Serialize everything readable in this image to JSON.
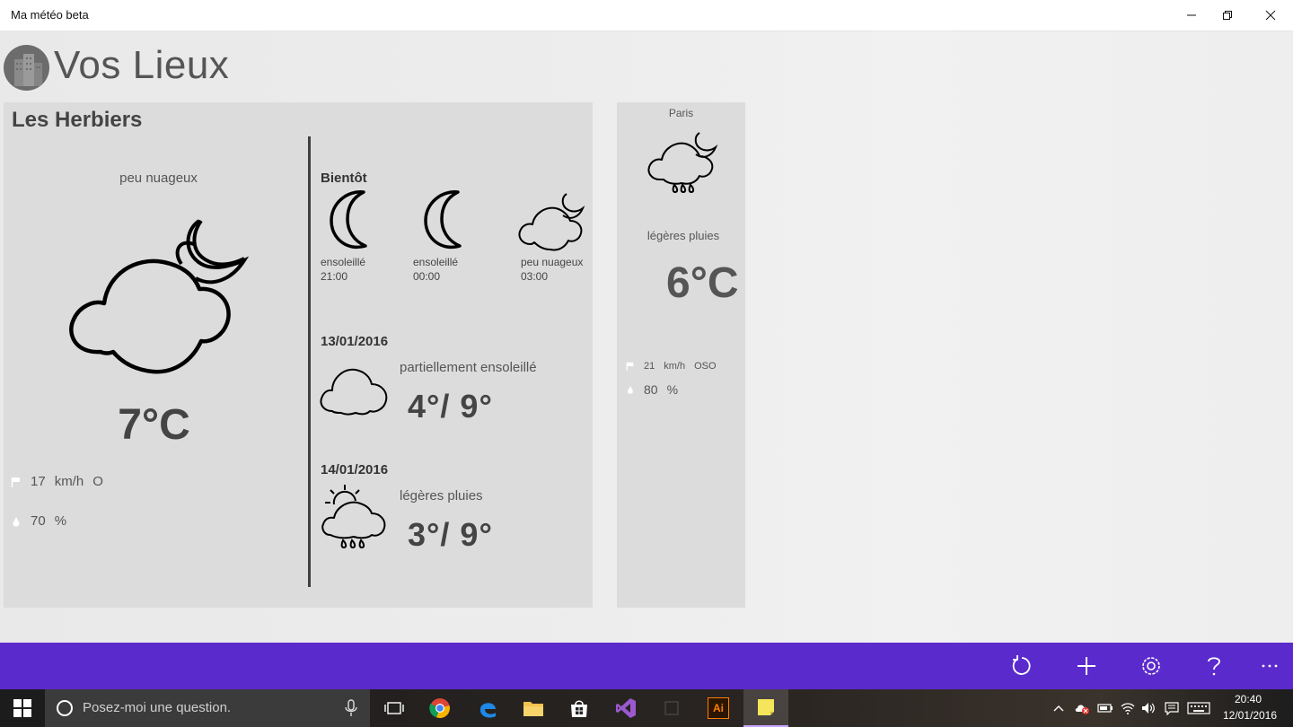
{
  "window": {
    "title": "Ma météo beta"
  },
  "header": {
    "title": "Vos Lieux"
  },
  "main_card": {
    "city": "Les Herbiers",
    "current": {
      "description": "peu nuageux",
      "temperature": "7°C",
      "wind_speed": "17",
      "wind_unit": "km/h",
      "wind_dir": "O",
      "humidity": "70",
      "humidity_unit": "%"
    },
    "soon": {
      "label": "Bientôt",
      "items": [
        {
          "description": "ensoleillé",
          "time": "21:00",
          "icon": "moon-icon"
        },
        {
          "description": "ensoleillé",
          "time": "00:00",
          "icon": "moon-icon"
        },
        {
          "description": "peu nuageux",
          "time": "03:00",
          "icon": "cloud-moon-icon"
        }
      ]
    },
    "days": [
      {
        "date": "13/01/2016",
        "description": "partiellement ensoleillé",
        "temps": "4°/ 9°",
        "icon": "cloud-icon"
      },
      {
        "date": "14/01/2016",
        "description": "légères pluies",
        "temps": "3°/ 9°",
        "icon": "sun-cloud-rain-icon"
      }
    ]
  },
  "paris_card": {
    "city": "Paris",
    "description": "légères pluies",
    "temperature": "6°C",
    "wind_speed": "21",
    "wind_unit": "km/h",
    "wind_dir": "OSO",
    "humidity": "80",
    "humidity_unit": "%",
    "icon": "cloud-moon-rain-icon"
  },
  "appbar": {
    "color": "#5b2acd",
    "buttons": [
      "refresh-icon",
      "add-icon",
      "settings-icon",
      "help-icon",
      "more-icon"
    ]
  },
  "taskbar": {
    "search_placeholder": "Posez-moi une question.",
    "time": "20:40",
    "date": "12/01/2016",
    "apps": [
      "task-view-icon",
      "chrome-icon",
      "edge-icon",
      "file-explorer-icon",
      "store-icon",
      "visual-studio-icon",
      "app-icon",
      "illustrator-icon",
      "sticky-notes-icon"
    ],
    "illustrator_label": "Ai"
  }
}
